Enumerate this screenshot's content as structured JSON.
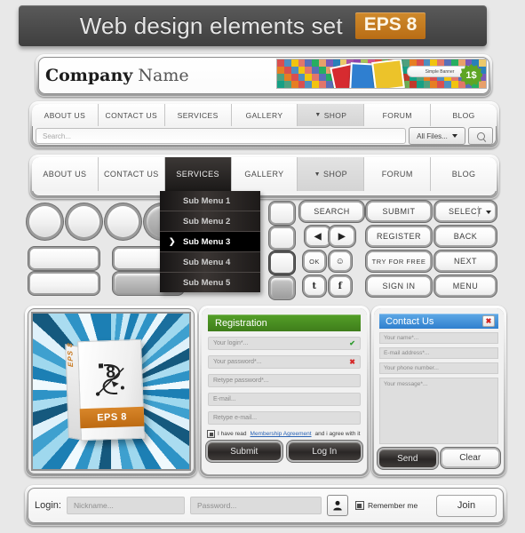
{
  "titlebar": {
    "title": "Web design elements set",
    "badge": "EPS 8"
  },
  "header": {
    "company_bold": "Company",
    "company_light": " Name",
    "banner_label": "Simple Banner",
    "banner_price": "1$"
  },
  "nav_top": {
    "items": [
      "ABOUT US",
      "CONTACT US",
      "SERVICES",
      "GALLERY",
      "SHOP",
      "FORUM",
      "BLOG"
    ],
    "shop_caret": "▼"
  },
  "search": {
    "placeholder": "Search...",
    "filter_label": "All Files...",
    "filter_caret": "▼",
    "icon": "search-icon"
  },
  "nav_bottom": {
    "items": [
      "ABOUT US",
      "CONTACT US",
      "SERVICES",
      "GALLERY",
      "SHOP",
      "FORUM",
      "BLOG"
    ],
    "active": "SERVICES",
    "shop_caret": "▼"
  },
  "submenu": {
    "items": [
      "Sub Menu 1",
      "Sub Menu 2",
      "Sub Menu 3",
      "Sub Menu 4",
      "Sub Menu 5"
    ],
    "selected": "Sub Menu 3"
  },
  "buttons": {
    "search": "SEARCH",
    "submit": "SUBMIT",
    "select": "SELECT",
    "select_caret": "▼",
    "prev": "◀",
    "next_arrow": "▶",
    "register": "REGISTER",
    "back": "BACK",
    "ok": "OK",
    "smiley": "☺",
    "try_for_free": "TRY FOR FREE",
    "next": "NEXT",
    "twitter": "t",
    "facebook": "f",
    "sign_in": "SIGN IN",
    "menu": "MENU"
  },
  "artwork": {
    "box_spine": "EPS 8",
    "box_band": "EPS 8",
    "box_glyph": "8"
  },
  "registration": {
    "title": "Registration",
    "fields": [
      {
        "placeholder": "Your login*...",
        "mark": "✔",
        "mark_state": "ok"
      },
      {
        "placeholder": "Your password*...",
        "mark": "✖",
        "mark_state": "bad"
      },
      {
        "placeholder": "Retype password*...",
        "mark": "",
        "mark_state": ""
      },
      {
        "placeholder": "E-mail...",
        "mark": "",
        "mark_state": ""
      },
      {
        "placeholder": "Retype e-mail...",
        "mark": "",
        "mark_state": ""
      }
    ],
    "agree_pre": "I have read ",
    "agree_link": "Membership Agreement",
    "agree_post": " and i agree with it",
    "submit_label": "Submit",
    "login_label": "Log In"
  },
  "contact": {
    "title": "Contact Us",
    "close": "✖",
    "fields": [
      "Your name*...",
      "E-mail address*...",
      "Your phone number..."
    ],
    "message_placeholder": "Your message*...",
    "send_label": "Send",
    "clear_label": "Clear"
  },
  "login_bar": {
    "label": "Login:",
    "nickname_placeholder": "Nickname...",
    "password_placeholder": "Password...",
    "remember_label": "Remember me",
    "join_label": "Join",
    "user_icon": "user-icon"
  },
  "colors": {
    "accent_orange": "#c87820",
    "registration_green": "#54a028",
    "contact_blue": "#2f7fce",
    "titlebar_dark": "#4c4c4c",
    "ok_green": "#2d9b2d",
    "error_red": "#d62828",
    "link_blue": "#2a63b5"
  }
}
